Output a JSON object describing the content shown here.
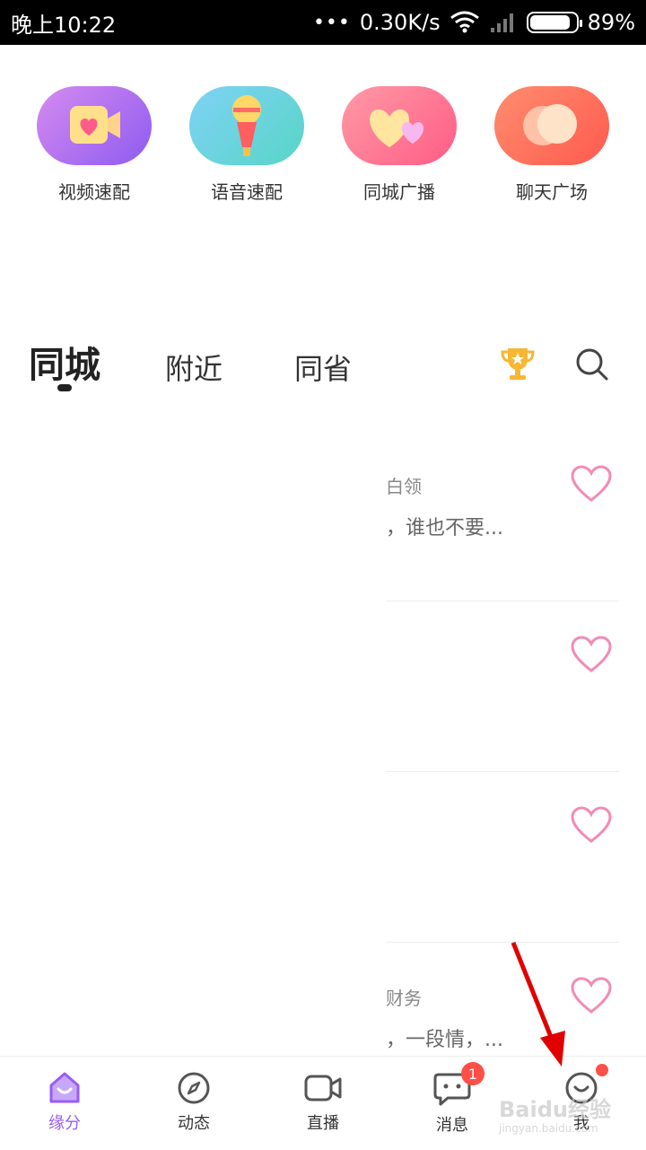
{
  "status": {
    "time": "晚上10:22",
    "dots": "•••",
    "speed": "0.30K/s",
    "battery": "89%",
    "battery_level": 0.89
  },
  "quick": [
    {
      "label": "视频速配",
      "icon": "video-match-icon"
    },
    {
      "label": "语音速配",
      "icon": "microphone-icon"
    },
    {
      "label": "同城广播",
      "icon": "hearts-icon"
    },
    {
      "label": "聊天广场",
      "icon": "chat-bubbles-icon"
    }
  ],
  "tabs": [
    "同城",
    "附近",
    "同省"
  ],
  "list": [
    {
      "tag": "白领",
      "text": "，谁也不要..."
    },
    {
      "tag": "",
      "text": ""
    },
    {
      "tag": "",
      "text": ""
    },
    {
      "tag": "财务",
      "text": "，一段情，..."
    }
  ],
  "nav": [
    {
      "label": "缘分",
      "icon": "home-icon"
    },
    {
      "label": "动态",
      "icon": "compass-icon"
    },
    {
      "label": "直播",
      "icon": "video-camera-icon"
    },
    {
      "label": "消息",
      "icon": "message-icon",
      "badge": "1"
    },
    {
      "label": "我",
      "icon": "smile-icon"
    }
  ],
  "watermark": {
    "main": "Baidu经验",
    "sub": "jingyan.baidu.com"
  },
  "colors": {
    "accent": "#9a5cf2",
    "heart": "#f28bb6",
    "badge": "#ff4f46",
    "arrow": "#e00000"
  }
}
